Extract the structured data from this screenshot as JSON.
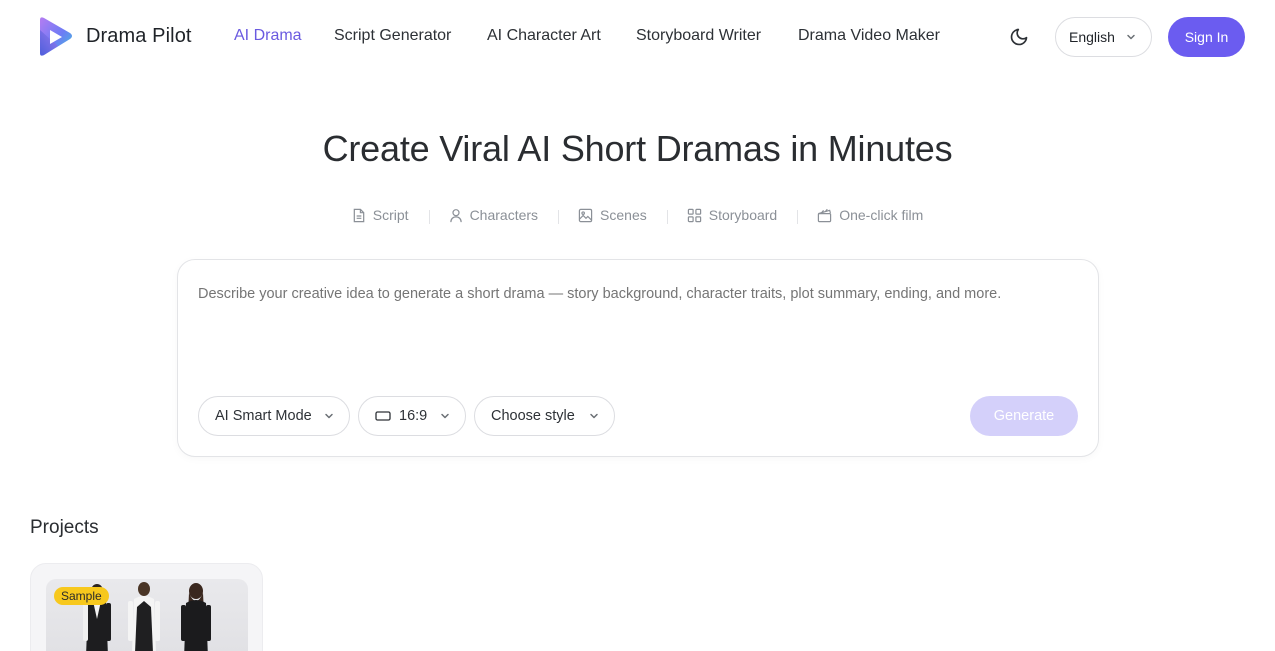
{
  "header": {
    "brand": "Drama Pilot",
    "nav": [
      {
        "label": "AI Drama",
        "active": true
      },
      {
        "label": "Script Generator",
        "active": false
      },
      {
        "label": "AI Character Art",
        "active": false
      },
      {
        "label": "Storyboard Writer",
        "active": false
      },
      {
        "label": "Drama Video Maker",
        "active": false
      }
    ],
    "theme_icon": "moon-icon",
    "language": "English",
    "signin_label": "Sign In"
  },
  "hero": {
    "title": "Create Viral AI Short Dramas in Minutes",
    "features": [
      {
        "label": "Script",
        "icon": "document-icon"
      },
      {
        "label": "Characters",
        "icon": "user-icon"
      },
      {
        "label": "Scenes",
        "icon": "image-icon"
      },
      {
        "label": "Storyboard",
        "icon": "grid-icon"
      },
      {
        "label": "One-click film",
        "icon": "clapperboard-icon"
      }
    ]
  },
  "prompt": {
    "placeholder": "Describe your creative idea to generate a short drama — story background, character traits, plot summary, ending, and more.",
    "mode": "AI Smart Mode",
    "ratio": "16:9",
    "style": "Choose style",
    "generate_label": "Generate"
  },
  "projects": {
    "title": "Projects",
    "items": [
      {
        "badge": "Sample"
      }
    ]
  },
  "colors": {
    "accent": "#6b5cf0",
    "accent_disabled": "#d4d0fa",
    "badge": "#f7c81d"
  }
}
